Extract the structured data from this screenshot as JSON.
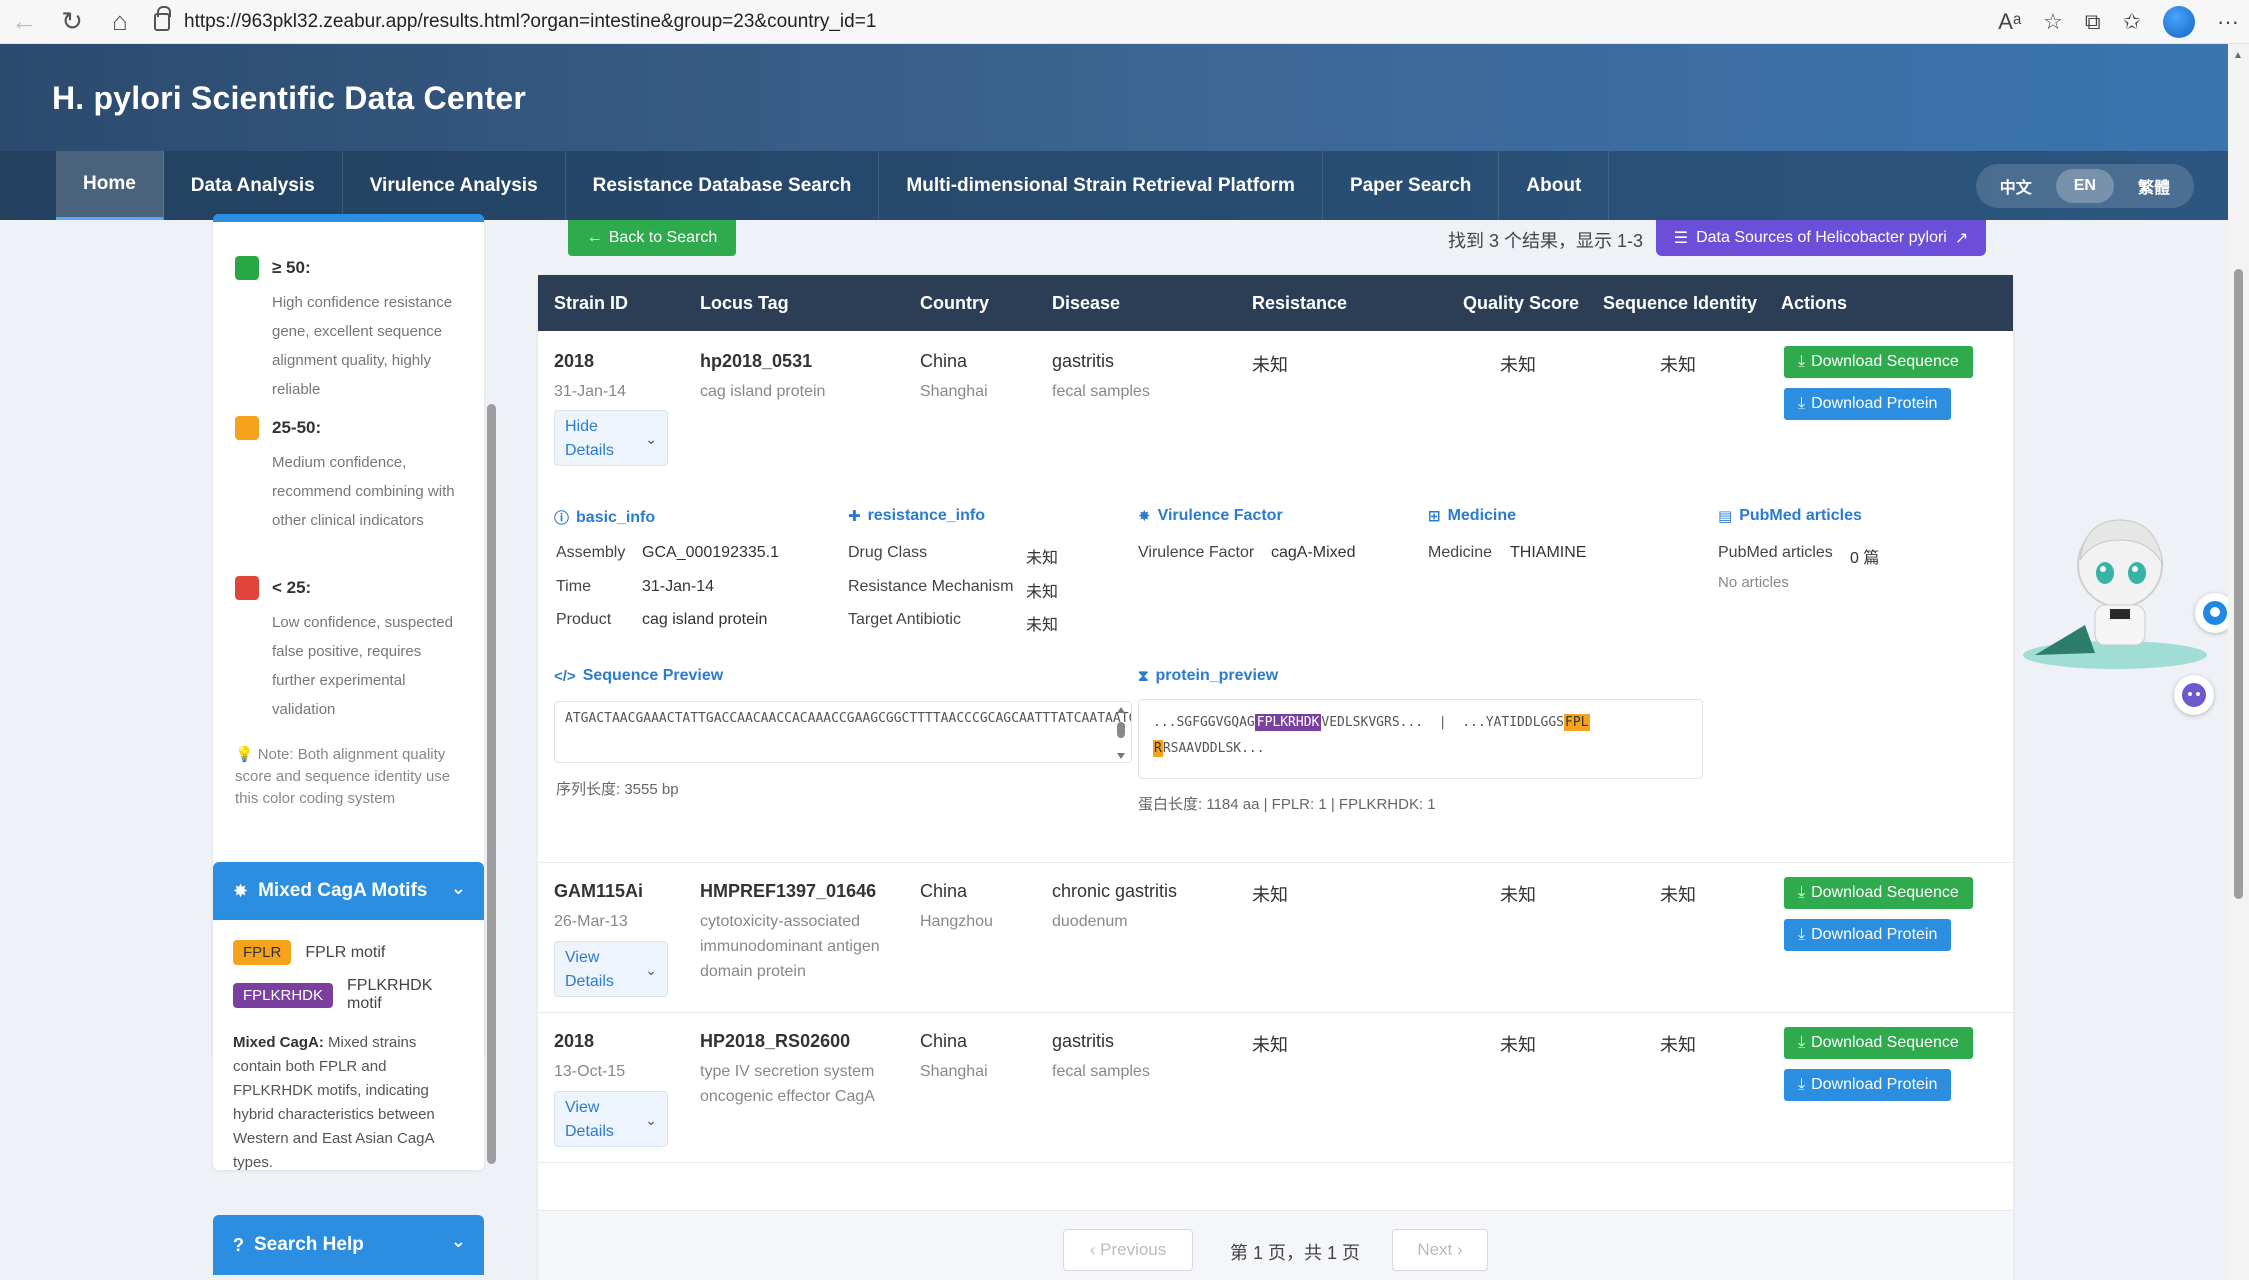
{
  "browser": {
    "url": "https://963pkl32.zeabur.app/results.html?organ=intestine&group=23&country_id=1"
  },
  "header": {
    "title": "H. pylori Scientific Data Center"
  },
  "nav": {
    "items": [
      "Home",
      "Data Analysis",
      "Virulence Analysis",
      "Resistance Database Search",
      "Multi-dimensional Strain Retrieval Platform",
      "Paper Search",
      "About"
    ],
    "languages": [
      "中文",
      "EN",
      "繁體"
    ]
  },
  "legend": {
    "items": [
      {
        "title": "≥ 50:",
        "desc": "High confidence resistance gene, excellent sequence alignment quality, highly reliable",
        "color": "#28a745"
      },
      {
        "title": "25-50:",
        "desc": "Medium confidence, recommend combining with other clinical indicators",
        "color": "#f5a31c"
      },
      {
        "title": "< 25:",
        "desc": "Low confidence, suspected false positive, requires further experimental validation",
        "color": "#e0443a"
      }
    ],
    "note": "Note: Both alignment quality score and sequence identity use this color coding system"
  },
  "motifs": {
    "title": "Mixed CagA Motifs",
    "fplr_chip": "FPLR",
    "fplr_label": "FPLR motif",
    "fplk_chip": "FPLKRHDK",
    "fplk_label": "FPLKRHDK motif",
    "desc_bold": "Mixed CagA:",
    "desc": " Mixed strains contain both FPLR and FPLKRHDK motifs, indicating hybrid characteristics between Western and East Asian CagA types."
  },
  "help": {
    "title": "Search Help"
  },
  "toolbar": {
    "back": "Back to Search",
    "result_count": "找到 3 个结果，显示 1-3",
    "sources": "Data Sources of Helicobacter pylori"
  },
  "table": {
    "headers": [
      "Strain ID",
      "Locus Tag",
      "Country",
      "Disease",
      "Resistance",
      "Quality Score",
      "Sequence Identity",
      "Actions"
    ],
    "download_seq": "Download Sequence",
    "download_prot": "Download Protein",
    "rows": [
      {
        "strain": "2018",
        "date": "31-Jan-14",
        "toggle": "Hide Details",
        "locus": "hp2018_0531",
        "product": "cag island protein",
        "country": "China",
        "city": "Shanghai",
        "disease": "gastritis",
        "sample": "fecal samples",
        "resistance": "未知",
        "quality": "未知",
        "identity": "未知"
      },
      {
        "strain": "GAM115Ai",
        "date": "26-Mar-13",
        "toggle": "View Details",
        "locus": "HMPREF1397_01646",
        "product": "cytotoxicity-associated immunodominant antigen domain protein",
        "country": "China",
        "city": "Hangzhou",
        "disease": "chronic gastritis",
        "sample": "duodenum",
        "resistance": "未知",
        "quality": "未知",
        "identity": "未知"
      },
      {
        "strain": "2018",
        "date": "13-Oct-15",
        "toggle": "View Details",
        "locus": "HP2018_RS02600",
        "product": "type IV secretion system oncogenic effector CagA",
        "country": "China",
        "city": "Shanghai",
        "disease": "gastritis",
        "sample": "fecal samples",
        "resistance": "未知",
        "quality": "未知",
        "identity": "未知"
      }
    ]
  },
  "details": {
    "basic_title": "basic_info",
    "assembly_label": "Assembly",
    "assembly": "GCA_000192335.1",
    "time_label": "Time",
    "time": "31-Jan-14",
    "product_label": "Product",
    "product": "cag island protein",
    "res_title": "resistance_info",
    "drug_label": "Drug Class",
    "drug": "未知",
    "mech_label": "Resistance Mechanism",
    "mech": "未知",
    "target_label": "Target Antibiotic",
    "target": "未知",
    "vir_title": "Virulence Factor",
    "vir_label": "Virulence Factor",
    "vir": "cagA-Mixed",
    "med_title": "Medicine",
    "med_label": "Medicine",
    "med": "THIAMINE",
    "pub_title": "PubMed articles",
    "pub_label": "PubMed articles",
    "pub": "0 篇",
    "pub_none": "No articles",
    "seq_title": "Sequence Preview",
    "seq_text": "ATGACTAACGAAACTATTGACCAACAACCACAAACCGAAGCGGCTTTTAACCCGCAGCAATTTATCAATAATCTTCAAGT...",
    "seq_len": "序列长度: 3555 bp",
    "prot_title": "protein_preview",
    "prot_a": "...SGFGGVGQAG",
    "prot_hl1": "FPLKRHDK",
    "prot_b": "VEDLSKVGRS...  |  ...YATIDDLGGS",
    "prot_hl2": "FPL",
    "prot_hl3": "R",
    "prot_c": "RSAAVDDLSK...",
    "prot_len": "蛋白长度: 1184 aa | FPLR: 1 | FPLKRHDK: 1"
  },
  "pagination": {
    "prev": "‹ Previous",
    "text": "第 1 页，共 1 页",
    "next": "Next ›"
  }
}
